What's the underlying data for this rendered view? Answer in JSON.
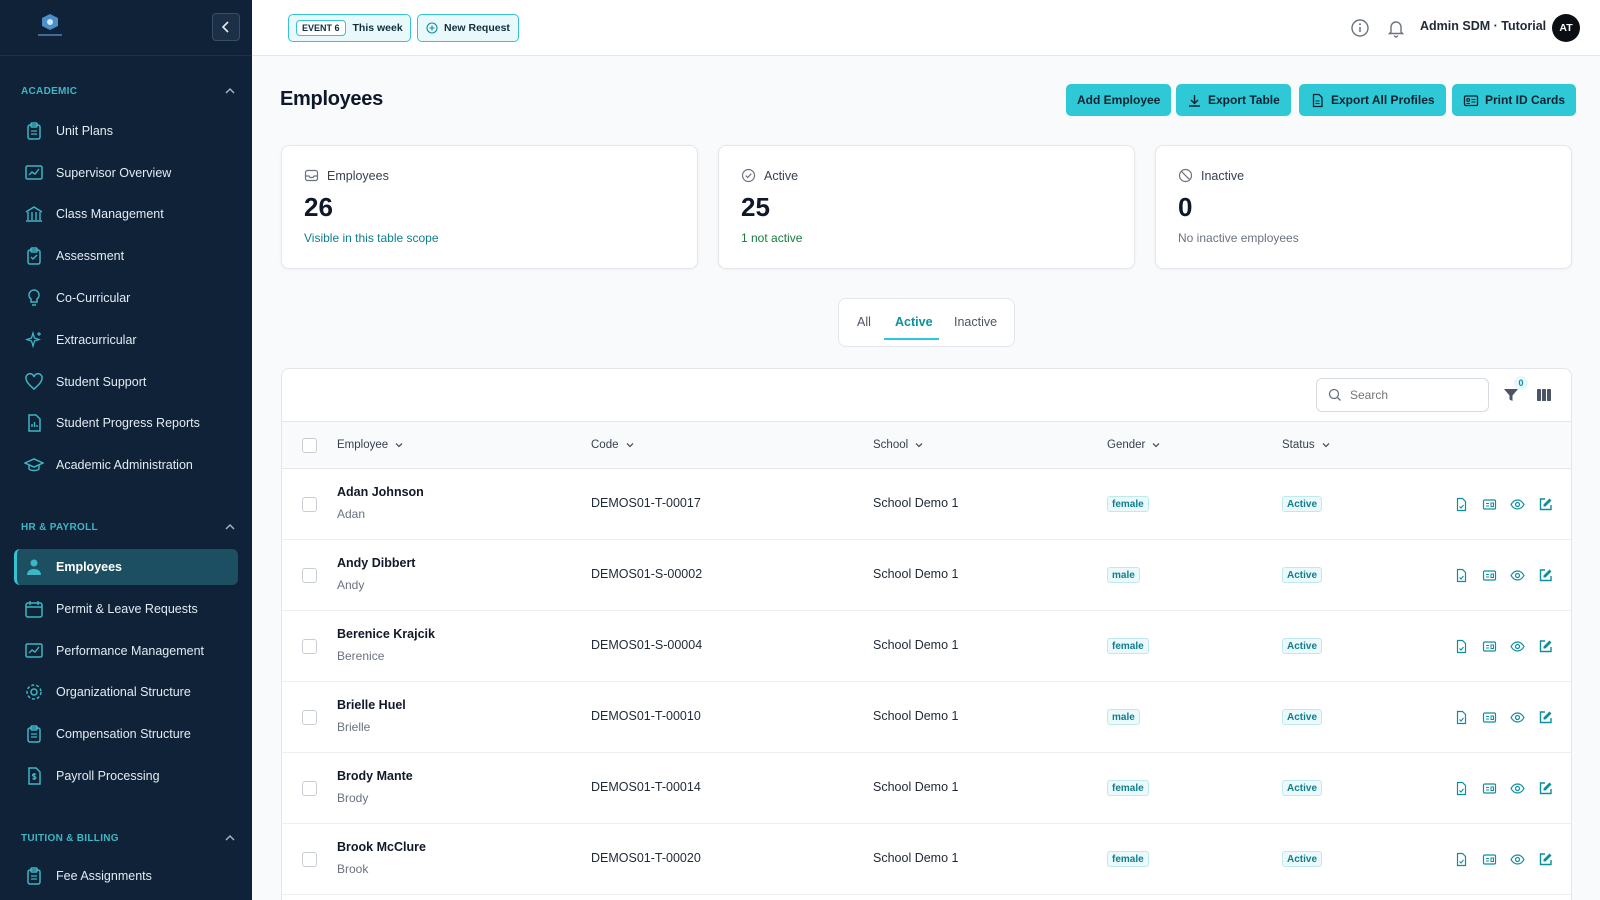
{
  "sidebar": {
    "sections": [
      {
        "label": "ACADEMIC",
        "items": [
          {
            "label": "Unit Plans",
            "icon": "clipboard-icon"
          },
          {
            "label": "Supervisor Overview",
            "icon": "chart-board-icon"
          },
          {
            "label": "Class Management",
            "icon": "building-icon"
          },
          {
            "label": "Assessment",
            "icon": "clipboard-check-icon"
          },
          {
            "label": "Co-Curricular",
            "icon": "lightbulb-icon"
          },
          {
            "label": "Extracurricular",
            "icon": "sparkles-icon"
          },
          {
            "label": "Student Support",
            "icon": "heart-icon"
          },
          {
            "label": "Student Progress Reports",
            "icon": "report-file-icon"
          },
          {
            "label": "Academic Administration",
            "icon": "graduation-cap-icon"
          }
        ]
      },
      {
        "label": "HR & PAYROLL",
        "items": [
          {
            "label": "Employees",
            "icon": "user-icon",
            "active": true
          },
          {
            "label": "Permit & Leave Requests",
            "icon": "calendar-icon"
          },
          {
            "label": "Performance Management",
            "icon": "chart-board-icon"
          },
          {
            "label": "Organizational Structure",
            "icon": "gear-icon"
          },
          {
            "label": "Compensation Structure",
            "icon": "clipboard-icon"
          },
          {
            "label": "Payroll Processing",
            "icon": "dollar-file-icon"
          }
        ]
      },
      {
        "label": "TUITION & BILLING",
        "items": [
          {
            "label": "Fee Assignments",
            "icon": "clipboard-icon"
          }
        ]
      }
    ]
  },
  "topbar": {
    "event_tag": "EVENT 6",
    "event_label": "This week",
    "new_request_label": "New Request",
    "user_name": "Admin SDM · Tutorial",
    "avatar_initials": "AT"
  },
  "page": {
    "title": "Employees",
    "actions": {
      "add_employee": "Add Employee",
      "export_table": "Export Table",
      "export_all_profiles": "Export All Profiles",
      "print_id_cards": "Print ID Cards"
    }
  },
  "stats": [
    {
      "label": "Employees",
      "value": "26",
      "note": "Visible in this table scope",
      "note_color": "#0e7f8e"
    },
    {
      "label": "Active",
      "value": "25",
      "note": "1 not active",
      "note_color": "#15803d"
    },
    {
      "label": "Inactive",
      "value": "0",
      "note": "No inactive employees",
      "note_color": "#6b7280"
    }
  ],
  "tabs": {
    "all": "All",
    "active": "Active",
    "inactive": "Inactive",
    "selected": "Active"
  },
  "table": {
    "search_placeholder": "Search",
    "filter_count": "0",
    "columns": {
      "employee": "Employee",
      "code": "Code",
      "school": "School",
      "gender": "Gender",
      "status": "Status"
    },
    "rows": [
      {
        "name": "Adan Johnson",
        "short": "Adan",
        "code": "DEMOS01-T-00017",
        "school": "School Demo 1",
        "gender": "female",
        "status": "Active"
      },
      {
        "name": "Andy Dibbert",
        "short": "Andy",
        "code": "DEMOS01-S-00002",
        "school": "School Demo 1",
        "gender": "male",
        "status": "Active"
      },
      {
        "name": "Berenice Krajcik",
        "short": "Berenice",
        "code": "DEMOS01-S-00004",
        "school": "School Demo 1",
        "gender": "female",
        "status": "Active"
      },
      {
        "name": "Brielle Huel",
        "short": "Brielle",
        "code": "DEMOS01-T-00010",
        "school": "School Demo 1",
        "gender": "male",
        "status": "Active"
      },
      {
        "name": "Brody Mante",
        "short": "Brody",
        "code": "DEMOS01-T-00014",
        "school": "School Demo 1",
        "gender": "female",
        "status": "Active"
      },
      {
        "name": "Brook McClure",
        "short": "Brook",
        "code": "DEMOS01-T-00020",
        "school": "School Demo 1",
        "gender": "female",
        "status": "Active"
      }
    ]
  },
  "colors": {
    "accent": "#2ec8d6",
    "sidebar_bg": "#0f2237",
    "active_nav": "#1d4f63"
  }
}
